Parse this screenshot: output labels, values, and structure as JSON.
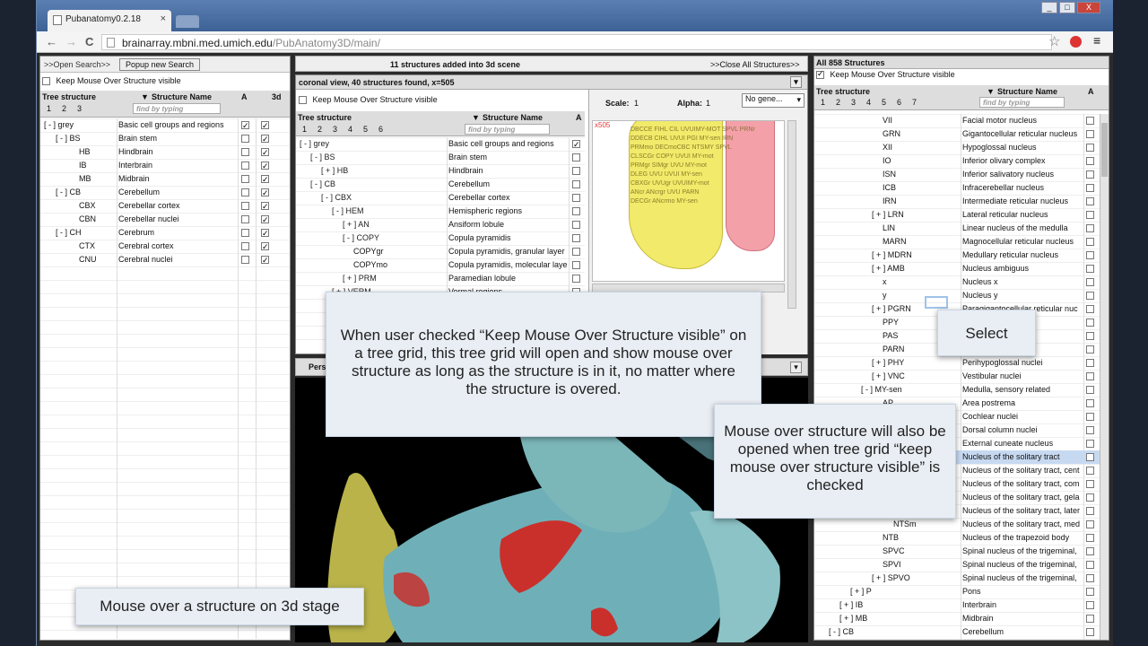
{
  "browser": {
    "tab_title": "Pubanatomy0.2.18",
    "tab_close": "×",
    "url_host": "brainarray.mbni.med.umich.edu",
    "url_path": "/PubAnatomy3D/main/",
    "back": "←",
    "forward": "→",
    "reload": "C",
    "star": "☆",
    "menu": "≡",
    "win_min": "_",
    "win_max": "□",
    "win_close": "X"
  },
  "left": {
    "open_search": ">>Open Search>>",
    "popup": "Popup new Search",
    "keep": "Keep Mouse Over Structure visible",
    "col_tree": "Tree structure",
    "col_levels": [
      "1",
      "2",
      "3"
    ],
    "col_name": "Structure Name",
    "col_a": "A",
    "col_3d": "3d",
    "filter": "find by typing",
    "rows": [
      {
        "t": "[ - ] grey",
        "n": "Basic cell groups and regions",
        "a": true,
        "d": true,
        "i": 0
      },
      {
        "t": "[ - ] BS",
        "n": "Brain stem",
        "a": false,
        "d": true,
        "i": 1
      },
      {
        "t": "HB",
        "n": "Hindbrain",
        "a": false,
        "d": true,
        "i": 3
      },
      {
        "t": "IB",
        "n": "Interbrain",
        "a": false,
        "d": true,
        "i": 3
      },
      {
        "t": "MB",
        "n": "Midbrain",
        "a": false,
        "d": true,
        "i": 3
      },
      {
        "t": "[ - ] CB",
        "n": "Cerebellum",
        "a": false,
        "d": true,
        "i": 1
      },
      {
        "t": "CBX",
        "n": "Cerebellar cortex",
        "a": false,
        "d": true,
        "i": 3
      },
      {
        "t": "CBN",
        "n": "Cerebellar nuclei",
        "a": false,
        "d": true,
        "i": 3
      },
      {
        "t": "[ - ] CH",
        "n": "Cerebrum",
        "a": false,
        "d": true,
        "i": 1
      },
      {
        "t": "CTX",
        "n": "Cerebral cortex",
        "a": false,
        "d": true,
        "i": 3
      },
      {
        "t": "CNU",
        "n": "Cerebral nuclei",
        "a": false,
        "d": true,
        "i": 3
      }
    ]
  },
  "center": {
    "status": "11 structures added into 3d scene",
    "close_all": ">>Close All Structures>>",
    "view_title": "coronal view, 40 structures found, x=505",
    "keep": "Keep Mouse Over Structure visible",
    "col_tree": "Tree structure",
    "col_levels": [
      "1",
      "2",
      "3",
      "4",
      "5",
      "6"
    ],
    "col_name": "Structure Name",
    "col_a": "A",
    "filter": "find by typing",
    "scale_label": "Scale:",
    "scale_value": "1",
    "alpha_label": "Alpha:",
    "alpha_value": "1",
    "gene": "No gene...",
    "slice_label": "x505",
    "persp": "Pers",
    "rows": [
      {
        "t": "[ - ] grey",
        "n": "Basic cell groups and regions",
        "a": true,
        "i": 0
      },
      {
        "t": "[ - ] BS",
        "n": "Brain stem",
        "a": false,
        "i": 1
      },
      {
        "t": "[ + ] HB",
        "n": "Hindbrain",
        "a": false,
        "i": 2
      },
      {
        "t": "[ - ] CB",
        "n": "Cerebellum",
        "a": false,
        "i": 1
      },
      {
        "t": "[ - ] CBX",
        "n": "Cerebellar cortex",
        "a": false,
        "i": 2
      },
      {
        "t": "[ - ] HEM",
        "n": "Hemispheric regions",
        "a": false,
        "i": 3
      },
      {
        "t": "[ + ] AN",
        "n": "Ansiform lobule",
        "a": false,
        "i": 4
      },
      {
        "t": "[ - ] COPY",
        "n": "Copula pyramidis",
        "a": false,
        "i": 4
      },
      {
        "t": "COPYgr",
        "n": "Copula pyramidis, granular layer",
        "a": false,
        "i": 5
      },
      {
        "t": "COPYmo",
        "n": "Copula pyramidis, molecular layer",
        "a": false,
        "i": 5
      },
      {
        "t": "[ + ] PRM",
        "n": "Paramedian lobule",
        "a": false,
        "i": 4
      },
      {
        "t": "[ + ] VERM",
        "n": "Vermal regions",
        "a": false,
        "i": 3
      }
    ]
  },
  "right": {
    "title": "All 858 Structures",
    "keep": "Keep Mouse Over Structure visible",
    "col_tree": "Tree structure",
    "col_levels": [
      "1",
      "2",
      "3",
      "4",
      "5",
      "6",
      "7"
    ],
    "col_name": "Structure Name",
    "col_a": "A",
    "filter": "find by typing",
    "rows": [
      {
        "t": "VII",
        "n": "Facial motor nucleus",
        "i": 6
      },
      {
        "t": "GRN",
        "n": "Gigantocellular reticular nucleus",
        "i": 6
      },
      {
        "t": "XII",
        "n": "Hypoglossal nucleus",
        "i": 6
      },
      {
        "t": "IO",
        "n": "Inferior olivary complex",
        "i": 6
      },
      {
        "t": "ISN",
        "n": "Inferior salivatory nucleus",
        "i": 6
      },
      {
        "t": "ICB",
        "n": "Infracerebellar nucleus",
        "i": 6
      },
      {
        "t": "IRN",
        "n": "Intermediate reticular nucleus",
        "i": 6
      },
      {
        "t": "[ + ] LRN",
        "n": "Lateral reticular nucleus",
        "i": 5
      },
      {
        "t": "LIN",
        "n": "Linear nucleus of the medulla",
        "i": 6
      },
      {
        "t": "MARN",
        "n": "Magnocellular reticular nucleus",
        "i": 6
      },
      {
        "t": "[ + ] MDRN",
        "n": "Medullary reticular nucleus",
        "i": 5
      },
      {
        "t": "[ + ] AMB",
        "n": "Nucleus ambiguus",
        "i": 5
      },
      {
        "t": "x",
        "n": "Nucleus x",
        "i": 6
      },
      {
        "t": "y",
        "n": "Nucleus y",
        "i": 6
      },
      {
        "t": "[ + ] PGRN",
        "n": "Paragigantocellular reticular nuc",
        "i": 5
      },
      {
        "t": "PPY",
        "n": "",
        "i": 6
      },
      {
        "t": "PAS",
        "n": "",
        "i": 6
      },
      {
        "t": "PARN",
        "n": "",
        "i": 6
      },
      {
        "t": "[ + ] PHY",
        "n": "Perihypoglossal nuclei",
        "i": 5
      },
      {
        "t": "[ + ] VNC",
        "n": "Vestibular nuclei",
        "i": 5
      },
      {
        "t": "[ - ] MY-sen",
        "n": "Medulla, sensory related",
        "i": 4
      },
      {
        "t": "AP",
        "n": "Area postrema",
        "i": 6
      },
      {
        "t": "",
        "n": "Cochlear nuclei",
        "i": 6
      },
      {
        "t": "",
        "n": "Dorsal column nuclei",
        "i": 6
      },
      {
        "t": "",
        "n": "External cuneate nucleus",
        "i": 6
      },
      {
        "t": "",
        "n": "Nucleus of the solitary tract",
        "i": 6
      },
      {
        "t": "",
        "n": "Nucleus of the solitary tract, cent",
        "i": 6
      },
      {
        "t": "",
        "n": "Nucleus of the solitary tract, com",
        "i": 6
      },
      {
        "t": "",
        "n": "Nucleus of the solitary tract, gela",
        "i": 6
      },
      {
        "t": "",
        "n": "Nucleus of the solitary tract, later",
        "i": 6
      },
      {
        "t": "NTSm",
        "n": "Nucleus of the solitary tract, med",
        "i": 7
      },
      {
        "t": "NTB",
        "n": "Nucleus of the trapezoid body",
        "i": 6
      },
      {
        "t": "SPVC",
        "n": "Spinal nucleus of the trigeminal,",
        "i": 6
      },
      {
        "t": "SPVI",
        "n": "Spinal nucleus of the trigeminal,",
        "i": 6
      },
      {
        "t": "[ + ] SPVO",
        "n": "Spinal nucleus of the trigeminal,",
        "i": 5
      },
      {
        "t": "[ + ] P",
        "n": "Pons",
        "i": 3
      },
      {
        "t": "[ + ] IB",
        "n": "Interbrain",
        "i": 2
      },
      {
        "t": "[ + ] MB",
        "n": "Midbrain",
        "i": 2
      },
      {
        "t": "[ - ] CB",
        "n": "Cerebellum",
        "i": 1
      }
    ]
  },
  "callouts": {
    "keep_mouse": "When user checked “Keep Mouse Over Structure visible” on a tree grid, this tree grid will open and show mouse over structure as long as the structure is in it, no matter where the structure is overed.",
    "select": "Select",
    "mouse_over": "Mouse over structure will also be opened when tree grid “keep mouse over structure visible” is checked",
    "stage": "Mouse over a structure on 3d stage"
  },
  "colors": {
    "browser_frame": "#2c4b74",
    "mesh_teal": "#6fb0b8",
    "mesh_red": "#c9302c",
    "mesh_yellow": "#b9b34a",
    "slice_yellow": "#f1ea6a",
    "slice_pink": "#f3a0a8"
  }
}
